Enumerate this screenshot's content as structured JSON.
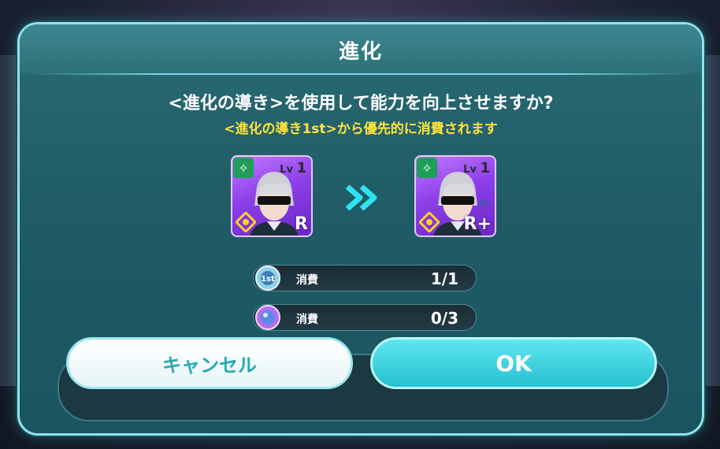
{
  "dialog": {
    "title": "進化",
    "question": "<進化の導き>を使用して能力を向上させますか?",
    "notice": "<進化の導き1st>から優先的に消費されます"
  },
  "cards": {
    "before": {
      "level_prefix": "Lv",
      "level": "1",
      "rarity": "R"
    },
    "after": {
      "level_prefix": "Lv",
      "level": "1",
      "rarity": "R+"
    }
  },
  "consume": [
    {
      "label": "消費",
      "value": "1/1",
      "item_icon": "evolution-guide-1st-icon"
    },
    {
      "label": "消費",
      "value": "0/3",
      "item_icon": "evolution-guide-icon"
    }
  ],
  "buttons": {
    "cancel": "キャンセル",
    "ok": "OK"
  },
  "colors": {
    "accent": "#8fe3ec",
    "notice": "#ffe33a",
    "ok_button": "#25c0cf",
    "card_purple": "#8d3fe8"
  }
}
